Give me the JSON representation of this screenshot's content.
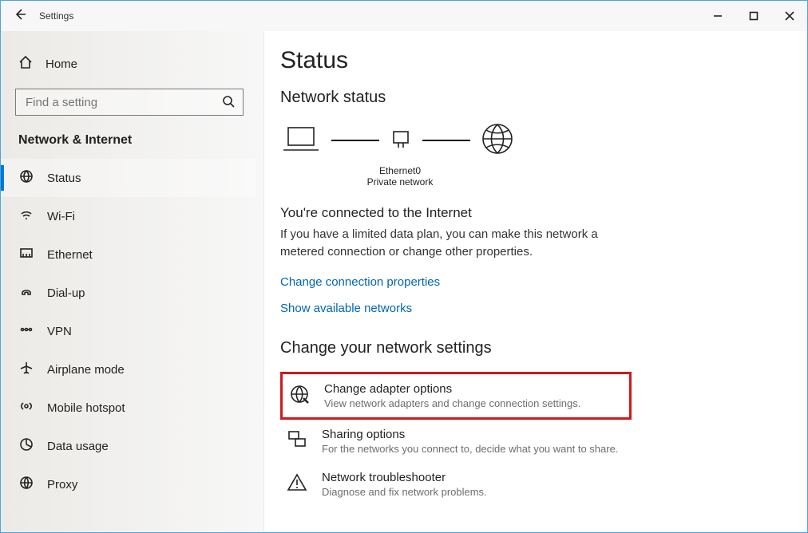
{
  "window": {
    "title": "Settings"
  },
  "sidebar": {
    "home": "Home",
    "search_placeholder": "Find a setting",
    "section": "Network & Internet",
    "items": [
      {
        "label": "Status"
      },
      {
        "label": "Wi-Fi"
      },
      {
        "label": "Ethernet"
      },
      {
        "label": "Dial-up"
      },
      {
        "label": "VPN"
      },
      {
        "label": "Airplane mode"
      },
      {
        "label": "Mobile hotspot"
      },
      {
        "label": "Data usage"
      },
      {
        "label": "Proxy"
      }
    ]
  },
  "main": {
    "title": "Status",
    "subtitle": "Network status",
    "diagram": {
      "adapter": "Ethernet0",
      "network_type": "Private network"
    },
    "connected_heading": "You're connected to the Internet",
    "connected_desc": "If you have a limited data plan, you can make this network a metered connection or change other properties.",
    "link_change_props": "Change connection properties",
    "link_show_networks": "Show available networks",
    "settings_heading": "Change your network settings",
    "rows": [
      {
        "title": "Change adapter options",
        "desc": "View network adapters and change connection settings."
      },
      {
        "title": "Sharing options",
        "desc": "For the networks you connect to, decide what you want to share."
      },
      {
        "title": "Network troubleshooter",
        "desc": "Diagnose and fix network problems."
      }
    ]
  }
}
